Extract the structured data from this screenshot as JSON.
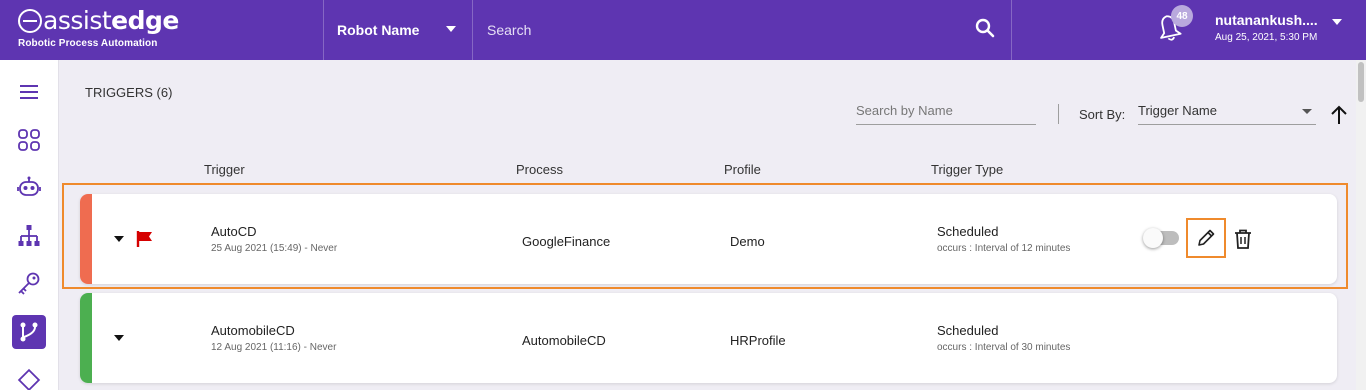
{
  "brand": {
    "logo_light": "assist",
    "logo_bold": "edge",
    "subtitle": "Robotic Process Automation"
  },
  "header": {
    "robot_select_label": "Robot Name",
    "search_placeholder": "Search",
    "notification_count": "48",
    "user_name": "nutanankush....",
    "user_datetime": "Aug 25, 2021, 5:30 PM"
  },
  "sidebar": {
    "items": [
      {
        "icon": "menu-icon"
      },
      {
        "icon": "dashboard-icon"
      },
      {
        "icon": "robot-icon"
      },
      {
        "icon": "hierarchy-icon"
      },
      {
        "icon": "key-icon"
      },
      {
        "icon": "triggers-icon",
        "active": true
      },
      {
        "icon": "chip-icon"
      }
    ]
  },
  "page": {
    "title": "TRIGGERS (6)",
    "name_search_placeholder": "Search by Name",
    "sort_label": "Sort By:",
    "sort_value": "Trigger Name"
  },
  "columns": {
    "trigger": "Trigger",
    "process": "Process",
    "profile": "Profile",
    "trigger_type": "Trigger Type"
  },
  "rows": [
    {
      "name": "AutoCD",
      "schedule": "25 Aug 2021 (15:49) - Never",
      "process": "GoogleFinance",
      "profile": "Demo",
      "type": "Scheduled",
      "interval": "occurs : Interval of 12 minutes",
      "status_color": "#ef6c50",
      "flagged": true,
      "enabled": false
    },
    {
      "name": "AutomobileCD",
      "schedule": "12 Aug 2021 (11:16) - Never",
      "process": "AutomobileCD",
      "profile": "HRProfile",
      "type": "Scheduled",
      "interval": "occurs : Interval of 30 minutes",
      "status_color": "#4caf50",
      "flagged": false,
      "enabled": false
    }
  ],
  "colors": {
    "header": "#5e35b1",
    "highlight": "#ef8a2c",
    "flag": "#d50000"
  }
}
